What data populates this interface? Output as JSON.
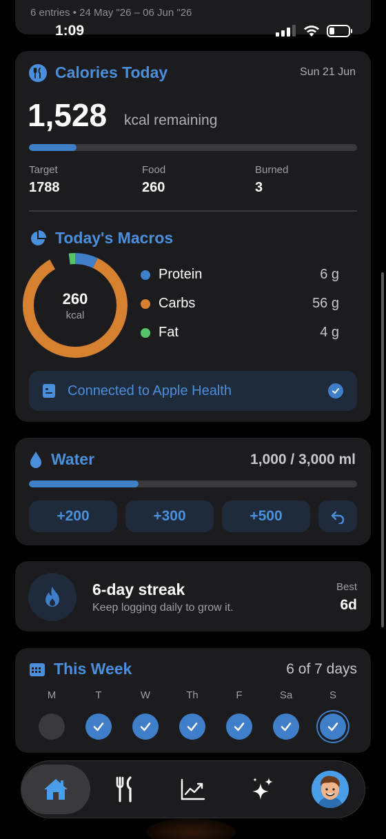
{
  "status_bar": {
    "time": "1:09"
  },
  "previous_card": {
    "entries": "6 entries • 24 May \"26 – 06 Jun \"26"
  },
  "calories": {
    "title": "Calories Today",
    "date": "Sun 21 Jun",
    "remaining": "1,528",
    "remaining_unit": "kcal remaining",
    "progress": 0.145,
    "stats": [
      {
        "label": "Target",
        "value": "1788"
      },
      {
        "label": "Food",
        "value": "260"
      },
      {
        "label": "Burned",
        "value": "3"
      }
    ]
  },
  "macros": {
    "title": "Today's Macros",
    "total": "260",
    "total_unit": "kcal",
    "items": [
      {
        "name": "Protein",
        "amount": "6 g",
        "color": "#3f7fc9",
        "grams": 6
      },
      {
        "name": "Carbs",
        "amount": "56 g",
        "color": "#d6812f",
        "grams": 56
      },
      {
        "name": "Fat",
        "amount": "4 g",
        "color": "#56c46a",
        "grams": 4
      }
    ]
  },
  "health": {
    "label": "Connected to Apple Health",
    "connected": true
  },
  "water": {
    "title": "Water",
    "amount": "1,000 / 3,000 ml",
    "progress": 0.333,
    "buttons": [
      "+200",
      "+300",
      "+500"
    ]
  },
  "streak": {
    "title": "6-day streak",
    "subtitle": "Keep logging daily to grow it.",
    "best_label": "Best",
    "best_value": "6d"
  },
  "week": {
    "title": "This Week",
    "count": "6 of 7 days",
    "days": [
      {
        "label": "M",
        "done": false,
        "today": false
      },
      {
        "label": "T",
        "done": true,
        "today": false
      },
      {
        "label": "W",
        "done": true,
        "today": false
      },
      {
        "label": "Th",
        "done": true,
        "today": false
      },
      {
        "label": "F",
        "done": true,
        "today": false
      },
      {
        "label": "Sa",
        "done": true,
        "today": false
      },
      {
        "label": "S",
        "done": true,
        "today": true
      }
    ]
  },
  "colors": {
    "accent": "#4a8fdc",
    "card": "#1c1c1e",
    "protein": "#3f7fc9",
    "carbs": "#d6812f",
    "fat": "#56c46a"
  },
  "tabs": [
    {
      "icon": "home-icon",
      "active": true
    },
    {
      "icon": "fork-knife-icon",
      "active": false
    },
    {
      "icon": "chart-icon",
      "active": false
    },
    {
      "icon": "sparkles-icon",
      "active": false
    },
    {
      "icon": "avatar",
      "active": false
    }
  ]
}
